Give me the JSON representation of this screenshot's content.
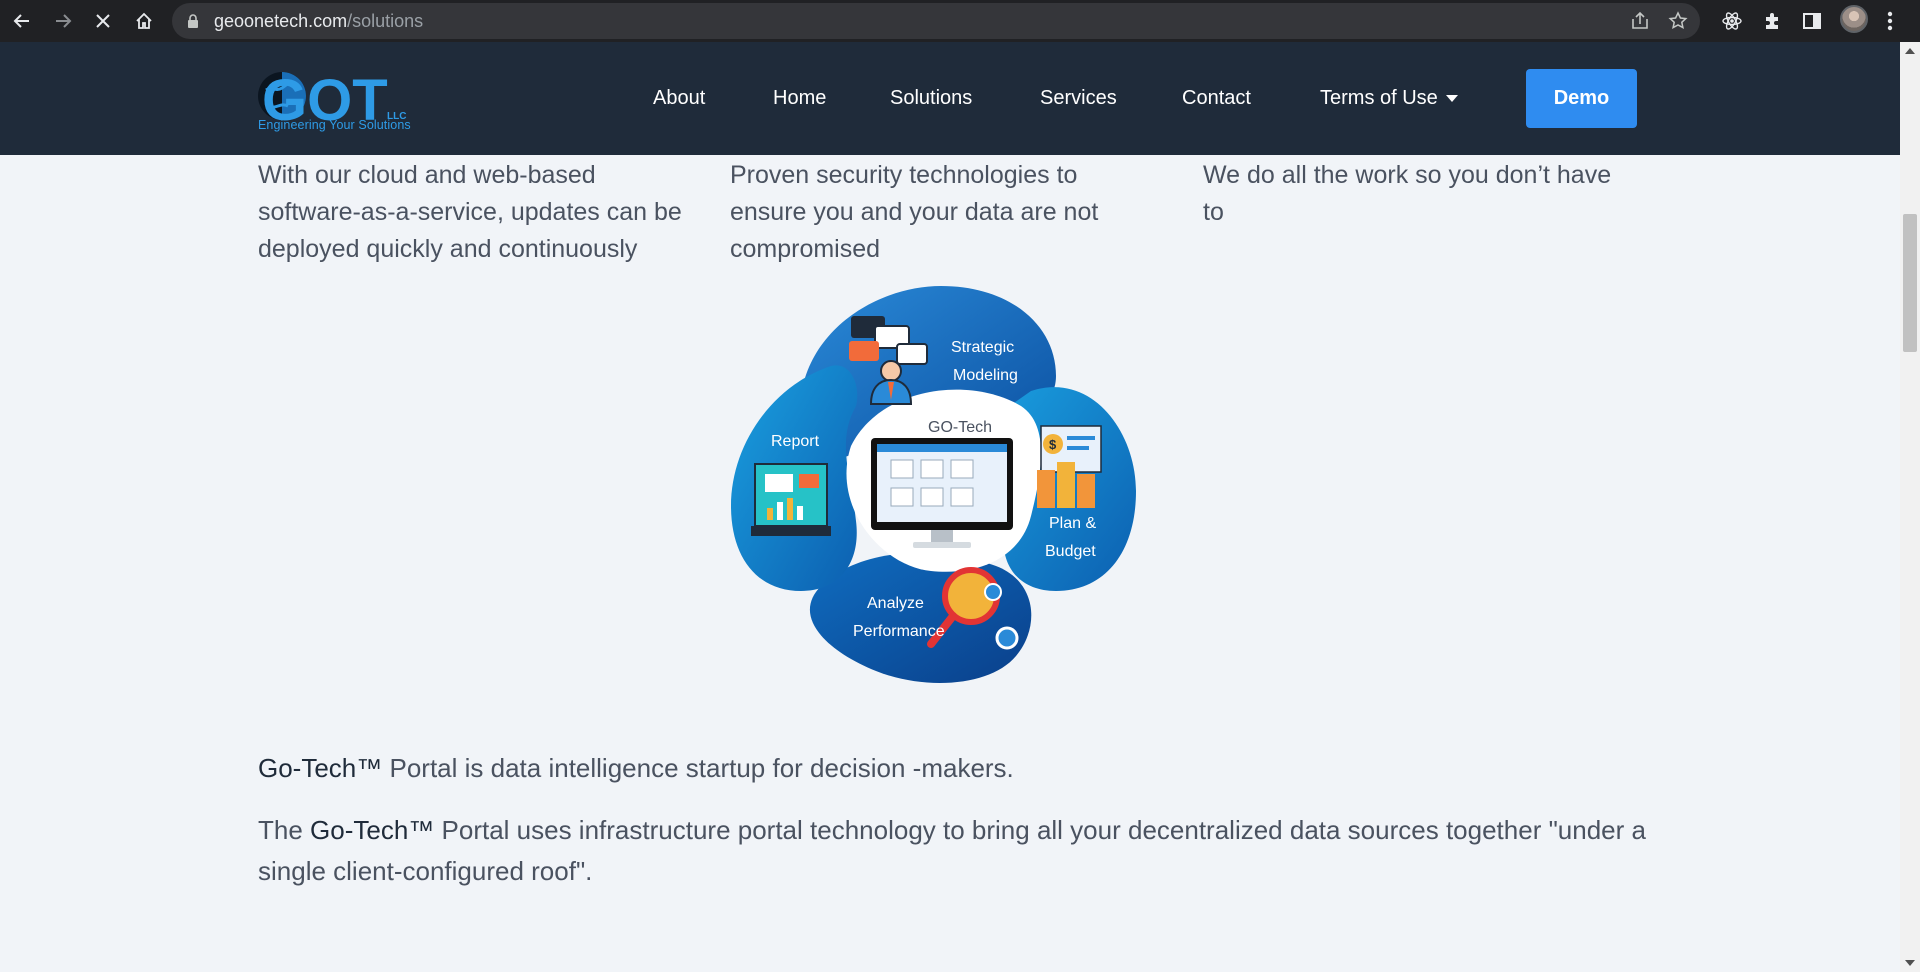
{
  "browser": {
    "url_domain": "geoonetech.com",
    "url_path": "/solutions",
    "icons": [
      "back-icon",
      "forward-icon",
      "stop-icon",
      "home-icon",
      "lock-icon",
      "share-icon",
      "bookmark-star-icon",
      "react-devtools-icon",
      "extensions-icon",
      "side-panel-icon",
      "profile-avatar",
      "menu-kebab-icon"
    ]
  },
  "site_header": {
    "logo_text": "GOT",
    "logo_suffix": "LLC",
    "logo_tagline": "Engineering Your Solutions",
    "menu": [
      "About",
      "Home",
      "Solutions",
      "Services",
      "Contact",
      "Terms of Use"
    ],
    "demo_label": "Demo",
    "colors": {
      "header_bg": "#1f2b3a",
      "accent": "#2f8cf0"
    }
  },
  "features": [
    "With our cloud and web-based software-as-a-service, updates can be deployed quickly and continuously",
    "Proven security technologies to ensure you and your data are not compromised",
    "We do all the work so you don’t have to"
  ],
  "diagram": {
    "center_label": "GO-Tech",
    "label_strategic_1": "Strategic",
    "label_strategic_2": "Modeling",
    "label_report": "Report",
    "label_plan_1": "Plan &",
    "label_plan_2": "Budget",
    "label_analyze_1": "Analyze",
    "label_analyze_2": "Performance"
  },
  "content": {
    "p1_brand": "Go-Tech™",
    "p1_rest": " Portal is data intelligence startup for decision -makers.",
    "p2_start": "The ",
    "p2_brand": "Go-Tech™",
    "p2_rest": " Portal uses infrastructure portal technology to bring all your decentralized data sources together \"under a single client-configured roof\"."
  }
}
